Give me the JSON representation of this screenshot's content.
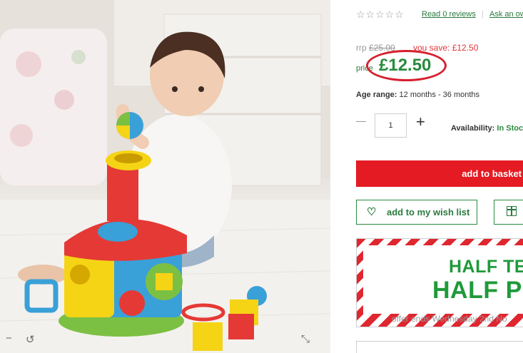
{
  "product": {
    "rating_stars": "☆☆☆☆☆",
    "reviews_link": "Read 0 reviews",
    "ask_link": "Ask an ow",
    "rrp_label": "rrp",
    "rrp_value": "£25.00",
    "save_text": "you save: £12.50",
    "price_label": "price",
    "price_value": "£12.50",
    "age_label": "Age range:",
    "age_value": "12 months - 36 months",
    "quantity": "1",
    "availability_label": "Availability:",
    "availability_value": "In Stoc"
  },
  "actions": {
    "add_to_basket": "add to basket",
    "add_to_wishlist": "add to my wish list"
  },
  "promo": {
    "line1": "HALF TER",
    "line2": "HALF PR",
    "ends": "offer ends Wednesday 2nd No"
  },
  "colors": {
    "brand_red": "#e41b23",
    "price_green": "#2a8a3e",
    "link_green": "#2a7a3f",
    "highlight_ring": "#d6202d"
  },
  "icons": {
    "photo_minus": "minus-icon",
    "photo_rotate": "rotate-icon",
    "photo_expand": "expand-icon",
    "wishlist": "heart-icon",
    "gift": "gift-icon"
  }
}
